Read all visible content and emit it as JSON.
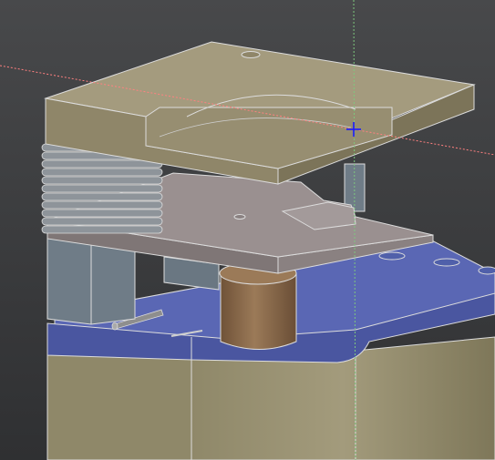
{
  "viewport": {
    "background_top": "#48494b",
    "background_bottom": "#2f3032"
  },
  "colors": {
    "top_plate": "#8f8669",
    "top_plate_face": "#7c7459",
    "top_plate_top": "#a49b7e",
    "middle_plate": "#9a9090",
    "middle_plate_edge": "#7f7676",
    "slate_block": "#6f7c87",
    "blue_base": "#4a56a0",
    "blue_base_top": "#5a67b4",
    "bottom_base": "#8f8869",
    "bottom_base_face": "#777055",
    "cylinder": "#8c6a4c",
    "edge": "#dcdcdc",
    "crosshair": "#1a1aff",
    "guide_red": "#ff8080",
    "guide_green": "#7ec87e"
  },
  "icons": {
    "cursor": "crosshair-cursor-icon"
  }
}
